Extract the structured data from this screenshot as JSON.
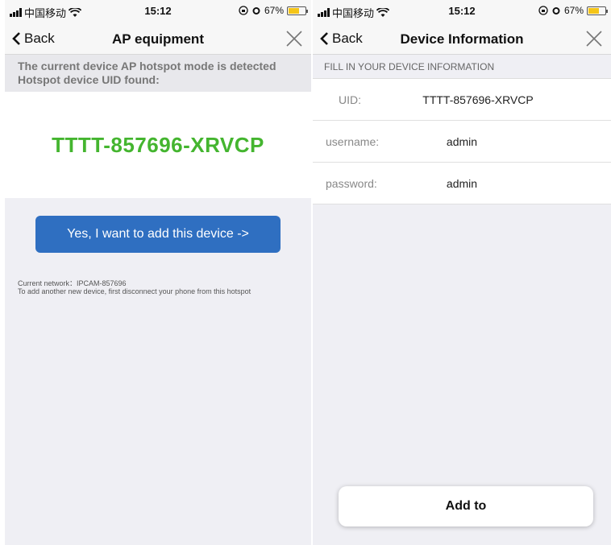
{
  "left_screen": {
    "status": {
      "carrier": "中国移动",
      "time": "15:12",
      "battery": "67%",
      "battery_level": 0.67
    },
    "nav": {
      "back_label": "Back",
      "title": "AP equipment"
    },
    "detect_line1": "The current device AP hotspot mode is detected",
    "detect_line2": "Hotspot device UID found:",
    "uid": "TTTT-857696-XRVCP",
    "add_button": "Yes, I want to add this device ->",
    "network_line1": "Current network：IPCAM-857696",
    "network_line2": "To add another new device, first disconnect your phone from this hotspot"
  },
  "right_screen": {
    "status": {
      "carrier": "中国移动",
      "time": "15:12",
      "battery": "67%",
      "battery_level": 0.67
    },
    "nav": {
      "back_label": "Back",
      "title": "Device Information"
    },
    "section_header": "FILL IN YOUR DEVICE INFORMATION",
    "fields": {
      "uid_label": "UID:",
      "uid_value": "TTTT-857696-XRVCP",
      "username_label": "username:",
      "username_value": "admin",
      "password_label": "password:",
      "password_value": "admin"
    },
    "add_to_button": "Add to"
  },
  "colors": {
    "uid_green": "#44b52f",
    "button_blue": "#2f6fc1",
    "battery_yellow": "#f5c518"
  }
}
